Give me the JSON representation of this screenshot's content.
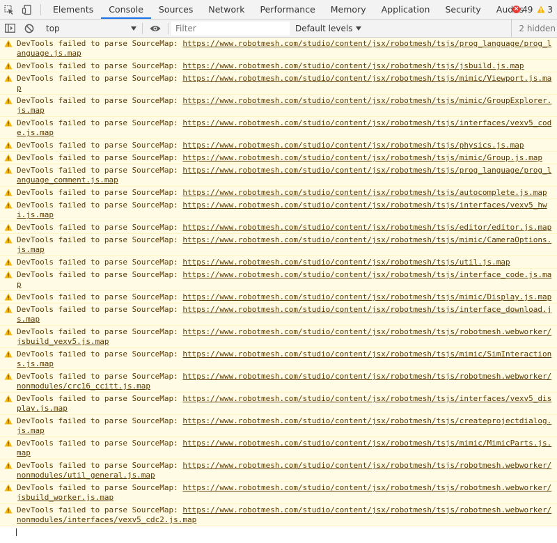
{
  "tabs": [
    {
      "label": "Elements",
      "active": false
    },
    {
      "label": "Console",
      "active": true
    },
    {
      "label": "Sources",
      "active": false
    },
    {
      "label": "Network",
      "active": false
    },
    {
      "label": "Performance",
      "active": false
    },
    {
      "label": "Memory",
      "active": false
    },
    {
      "label": "Application",
      "active": false
    },
    {
      "label": "Security",
      "active": false
    },
    {
      "label": "Audits",
      "active": false
    }
  ],
  "counts": {
    "errors": "49",
    "warnings": "3"
  },
  "toolbar": {
    "context": "top",
    "filter_placeholder": "Filter",
    "levels_label": "Default levels",
    "hidden_label": "2 hidden"
  },
  "colors": {
    "warning_bg": "#fffbe5",
    "warning_text": "#5c3c00",
    "warning_icon": "#f4b400",
    "error_icon": "#e53935",
    "active_tab": "#1a73e8"
  },
  "messages": [
    {
      "prefix": "DevTools failed to parse SourceMap: ",
      "url": "https://www.robotmesh.com/studio/content/jsx/robotmesh/tsjs/prog_language/prog_language.js.map"
    },
    {
      "prefix": "DevTools failed to parse SourceMap: ",
      "url": "https://www.robotmesh.com/studio/content/jsx/robotmesh/tsjs/jsbuild.js.map"
    },
    {
      "prefix": "DevTools failed to parse SourceMap: ",
      "url": "https://www.robotmesh.com/studio/content/jsx/robotmesh/tsjs/mimic/Viewport.js.map"
    },
    {
      "prefix": "DevTools failed to parse SourceMap: ",
      "url": "https://www.robotmesh.com/studio/content/jsx/robotmesh/tsjs/mimic/GroupExplorer.js.map"
    },
    {
      "prefix": "DevTools failed to parse SourceMap: ",
      "url": "https://www.robotmesh.com/studio/content/jsx/robotmesh/tsjs/interfaces/vexv5_code.js.map"
    },
    {
      "prefix": "DevTools failed to parse SourceMap: ",
      "url": "https://www.robotmesh.com/studio/content/jsx/robotmesh/tsjs/physics.js.map"
    },
    {
      "prefix": "DevTools failed to parse SourceMap: ",
      "url": "https://www.robotmesh.com/studio/content/jsx/robotmesh/tsjs/mimic/Group.js.map"
    },
    {
      "prefix": "DevTools failed to parse SourceMap: ",
      "url": "https://www.robotmesh.com/studio/content/jsx/robotmesh/tsjs/prog_language/prog_language_comment.js.map"
    },
    {
      "prefix": "DevTools failed to parse SourceMap: ",
      "url": "https://www.robotmesh.com/studio/content/jsx/robotmesh/tsjs/autocomplete.js.map"
    },
    {
      "prefix": "DevTools failed to parse SourceMap: ",
      "url": "https://www.robotmesh.com/studio/content/jsx/robotmesh/tsjs/interfaces/vexv5_hwi.js.map"
    },
    {
      "prefix": "DevTools failed to parse SourceMap: ",
      "url": "https://www.robotmesh.com/studio/content/jsx/robotmesh/tsjs/editor/editor.js.map"
    },
    {
      "prefix": "DevTools failed to parse SourceMap: ",
      "url": "https://www.robotmesh.com/studio/content/jsx/robotmesh/tsjs/mimic/CameraOptions.js.map"
    },
    {
      "prefix": "DevTools failed to parse SourceMap: ",
      "url": "https://www.robotmesh.com/studio/content/jsx/robotmesh/tsjs/util.js.map"
    },
    {
      "prefix": "DevTools failed to parse SourceMap: ",
      "url": "https://www.robotmesh.com/studio/content/jsx/robotmesh/tsjs/interface_code.js.map"
    },
    {
      "prefix": "DevTools failed to parse SourceMap: ",
      "url": "https://www.robotmesh.com/studio/content/jsx/robotmesh/tsjs/mimic/Display.js.map"
    },
    {
      "prefix": "DevTools failed to parse SourceMap: ",
      "url": "https://www.robotmesh.com/studio/content/jsx/robotmesh/tsjs/interface_download.js.map"
    },
    {
      "prefix": "DevTools failed to parse SourceMap: ",
      "url": "https://www.robotmesh.com/studio/content/jsx/robotmesh/tsjs/robotmesh.webworker/jsbuild_vexv5.js.map"
    },
    {
      "prefix": "DevTools failed to parse SourceMap: ",
      "url": "https://www.robotmesh.com/studio/content/jsx/robotmesh/tsjs/mimic/SimInteractions.js.map"
    },
    {
      "prefix": "DevTools failed to parse SourceMap: ",
      "url": "https://www.robotmesh.com/studio/content/jsx/robotmesh/tsjs/robotmesh.webworker/nonmodules/crc16_ccitt.js.map"
    },
    {
      "prefix": "DevTools failed to parse SourceMap: ",
      "url": "https://www.robotmesh.com/studio/content/jsx/robotmesh/tsjs/interfaces/vexv5_display.js.map"
    },
    {
      "prefix": "DevTools failed to parse SourceMap: ",
      "url": "https://www.robotmesh.com/studio/content/jsx/robotmesh/tsjs/createprojectdialog.js.map"
    },
    {
      "prefix": "DevTools failed to parse SourceMap: ",
      "url": "https://www.robotmesh.com/studio/content/jsx/robotmesh/tsjs/mimic/MimicParts.js.map"
    },
    {
      "prefix": "DevTools failed to parse SourceMap: ",
      "url": "https://www.robotmesh.com/studio/content/jsx/robotmesh/tsjs/robotmesh.webworker/nonmodules/util_general.js.map"
    },
    {
      "prefix": "DevTools failed to parse SourceMap: ",
      "url": "https://www.robotmesh.com/studio/content/jsx/robotmesh/tsjs/robotmesh.webworker/jsbuild_worker.js.map"
    },
    {
      "prefix": "DevTools failed to parse SourceMap: ",
      "url": "https://www.robotmesh.com/studio/content/jsx/robotmesh/tsjs/robotmesh.webworker/nonmodules/interfaces/vexv5_cdc2.js.map"
    }
  ]
}
